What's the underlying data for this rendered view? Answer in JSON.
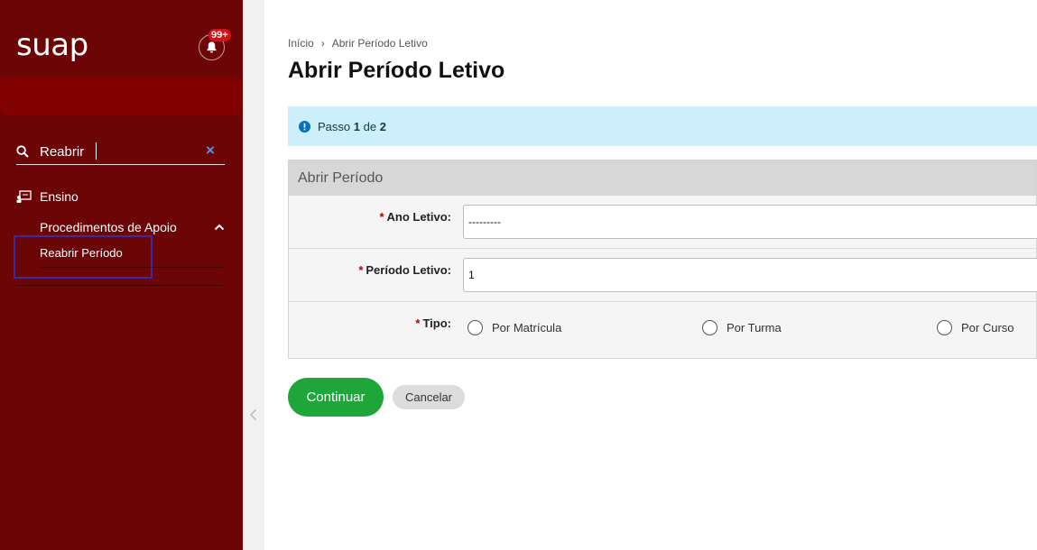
{
  "sidebar": {
    "logo": "suap",
    "notification_badge": "99+",
    "search": {
      "value": "Reabrir",
      "clear_label": "×"
    },
    "menu": {
      "section_label": "Ensino",
      "group_label": "Procedimentos de Apoio",
      "item_label": "Reabrir Período"
    }
  },
  "breadcrumb": {
    "home": "Início",
    "separator": "›",
    "current": "Abrir Período Letivo"
  },
  "page_title": "Abrir Período Letivo",
  "alert": {
    "prefix": "Passo",
    "current_step": "1",
    "middle": "de",
    "total_steps": "2"
  },
  "form": {
    "title": "Abrir Período",
    "required_mark": "*",
    "ano_letivo": {
      "label": "Ano Letivo:",
      "value": "---------"
    },
    "periodo_letivo": {
      "label": "Período Letivo:",
      "value": "1"
    },
    "tipo": {
      "label": "Tipo:",
      "options": [
        "Por Matrícula",
        "Por Turma",
        "Por Curso"
      ]
    }
  },
  "actions": {
    "submit": "Continuar",
    "cancel": "Cancelar"
  },
  "colors": {
    "sidebar_bg": "#6c0506",
    "primary_green": "#1ea63b",
    "alert_bg": "#cdeefb",
    "badge_red": "#d4111b"
  }
}
